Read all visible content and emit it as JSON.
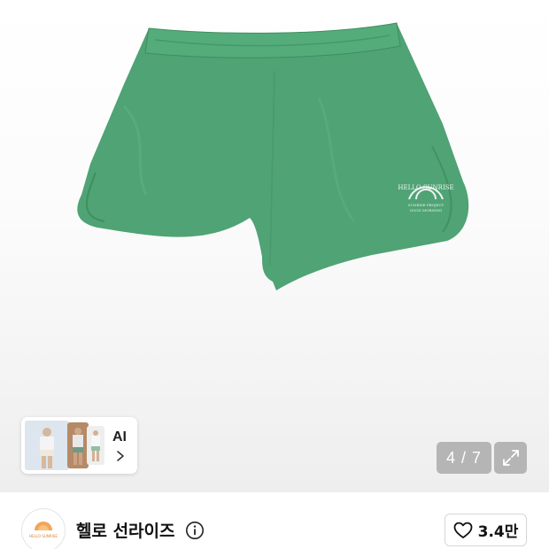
{
  "gallery": {
    "ai_chip_label": "AI",
    "page_counter": "4 / 7",
    "product_print": {
      "line1": "HELLO SUNRISE",
      "line2": "SUNRISE PROJECT",
      "line3": "GOOD MORNING"
    }
  },
  "brand": {
    "name": "헬로 선라이즈",
    "logo_text": "HELLO SUNRISE"
  },
  "like": {
    "count": "3.4만"
  },
  "colors": {
    "shorts_green": "#4fa374",
    "shorts_shadow": "#3f8d61",
    "counter_bg": "#aaaaaa"
  },
  "icons": {
    "ai_chevron": "chevron-right-icon",
    "expand": "expand-icon",
    "info": "info-icon",
    "like": "heart-outline-icon"
  }
}
